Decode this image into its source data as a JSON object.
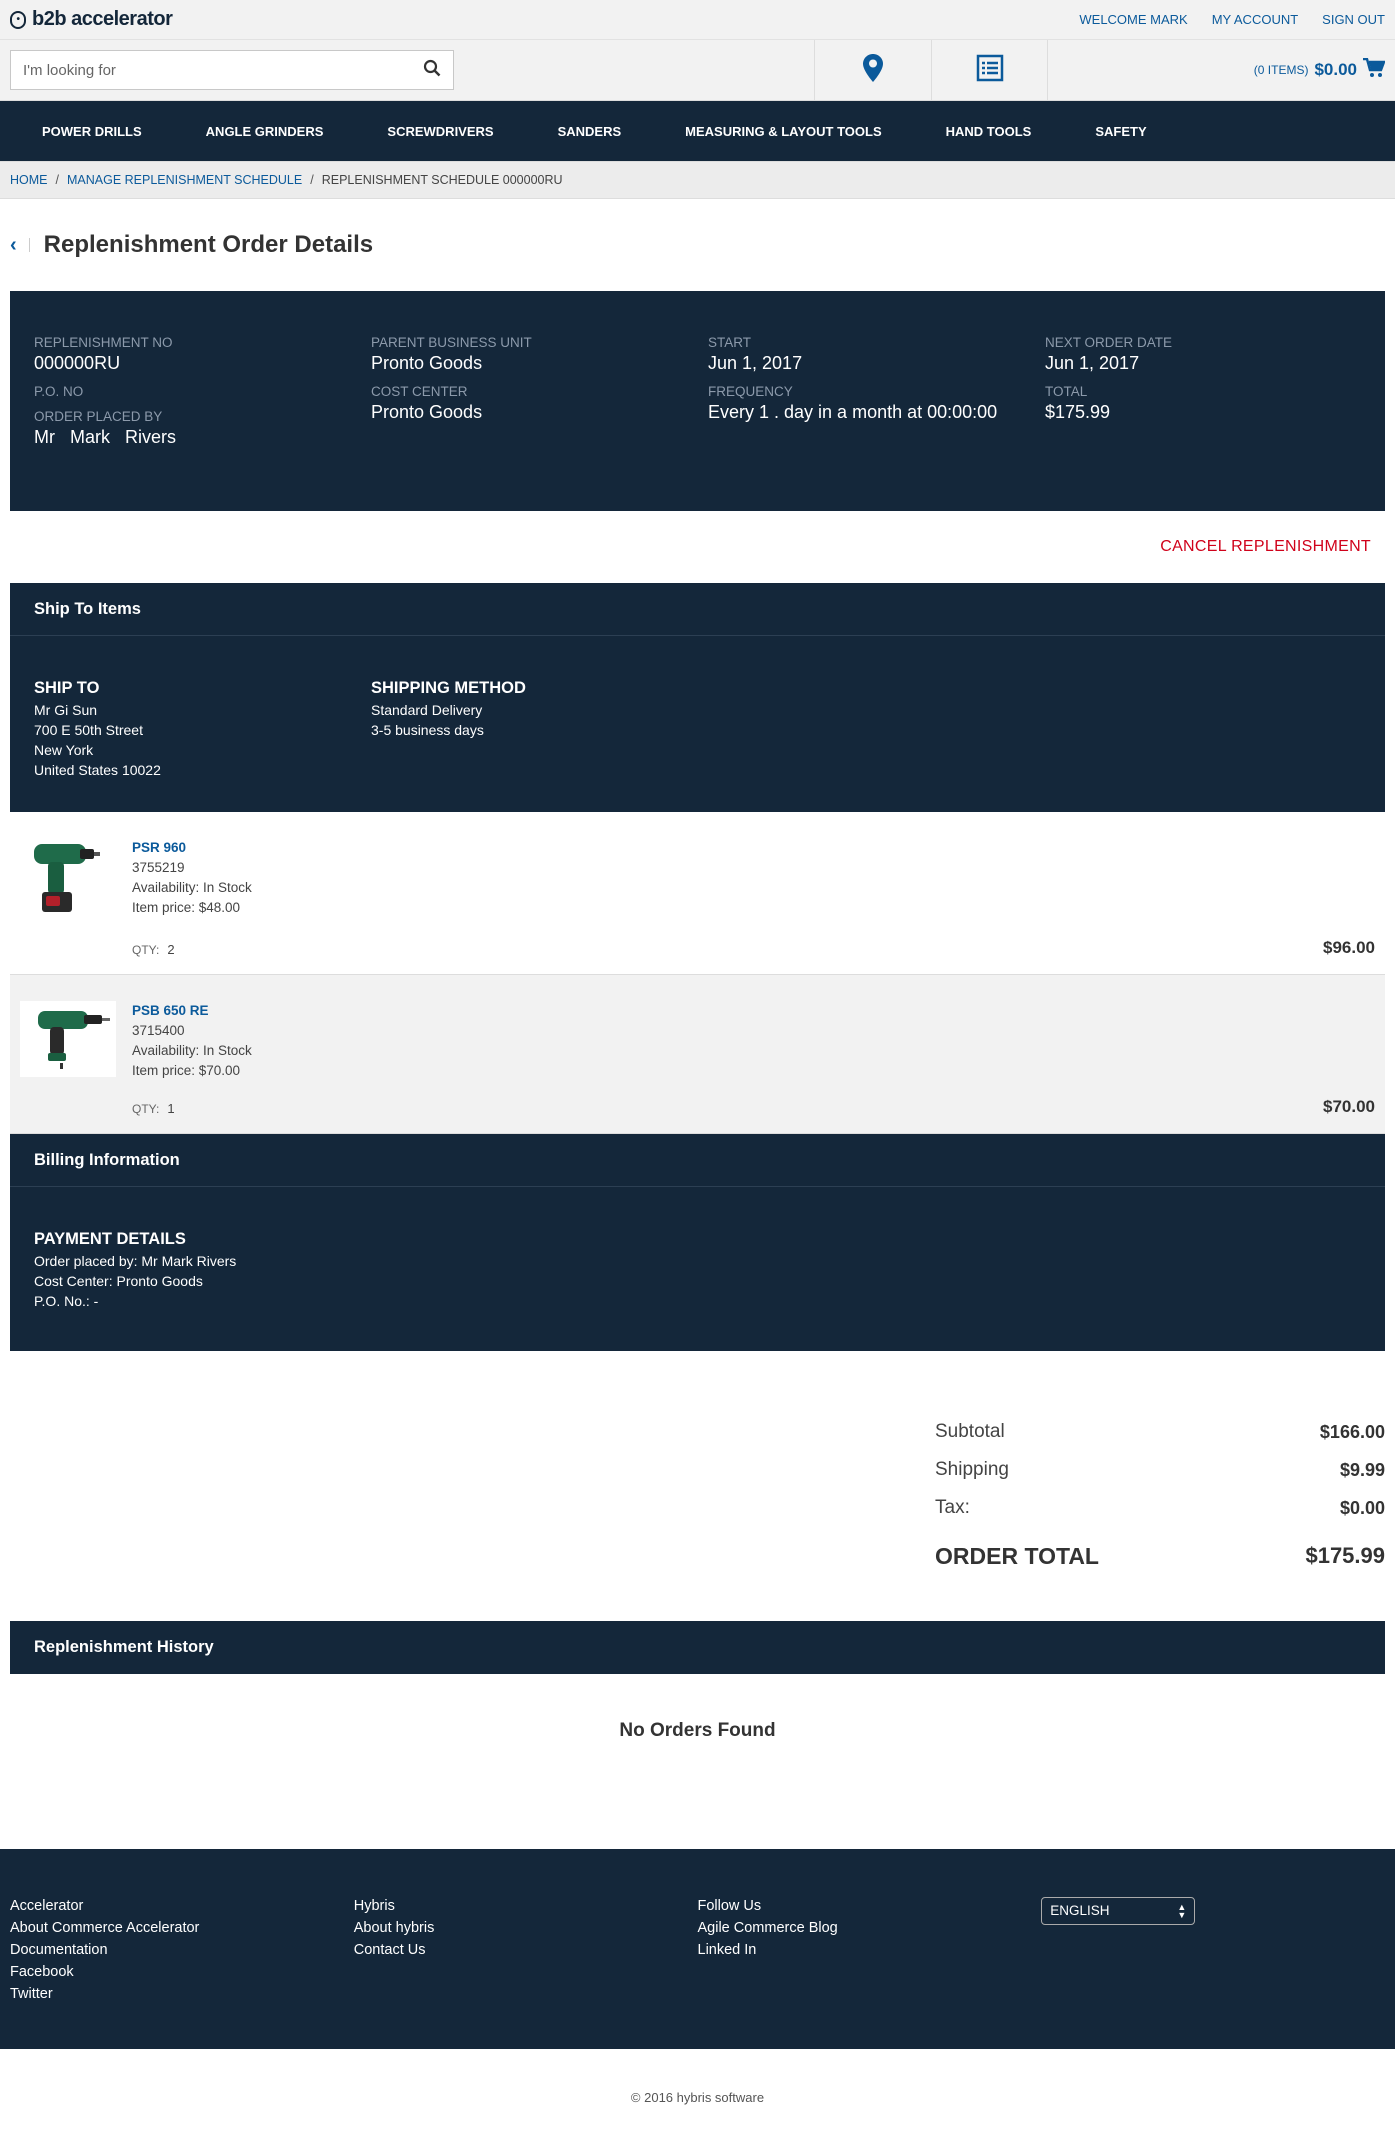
{
  "header": {
    "logo_text": "b2b accelerator",
    "welcome": "WELCOME MARK",
    "my_account": "MY ACCOUNT",
    "sign_out": "SIGN OUT",
    "search_placeholder": "I'm looking for",
    "cart_items": "(0 ITEMS)",
    "cart_total": "$0.00"
  },
  "nav": [
    "POWER DRILLS",
    "ANGLE GRINDERS",
    "SCREWDRIVERS",
    "SANDERS",
    "MEASURING & LAYOUT TOOLS",
    "HAND TOOLS",
    "SAFETY"
  ],
  "breadcrumb": {
    "home": "HOME",
    "manage": "MANAGE REPLENISHMENT SCHEDULE",
    "current": "REPLENISHMENT SCHEDULE 000000RU"
  },
  "page_title": "Replenishment Order Details",
  "summary": {
    "replenishment_no_label": "REPLENISHMENT NO",
    "replenishment_no": "000000RU",
    "po_no_label": "P.O. NO",
    "order_placed_by_label": "ORDER PLACED BY",
    "order_placed_by": "Mr  Mark  Rivers",
    "parent_bu_label": "PARENT BUSINESS UNIT",
    "parent_bu": "Pronto Goods",
    "cost_center_label": "COST CENTER",
    "cost_center": "Pronto Goods",
    "start_label": "START",
    "start": "Jun 1, 2017",
    "frequency_label": "FREQUENCY",
    "frequency": "Every 1 . day in a month at 00:00:00",
    "next_order_label": "NEXT ORDER DATE",
    "next_order": "Jun 1, 2017",
    "total_label": "TOTAL",
    "total": "$175.99"
  },
  "cancel_label": "CANCEL REPLENISHMENT",
  "ship_section": {
    "heading": "Ship To Items",
    "ship_to_title": "SHIP TO",
    "ship_to_lines": [
      "Mr  Gi Sun",
      "700 E 50th Street",
      "New York",
      "United States 10022"
    ],
    "method_title": "SHIPPING METHOD",
    "method_lines": [
      "Standard Delivery",
      "3-5 business days"
    ]
  },
  "items": [
    {
      "name": "PSR 960",
      "code": "3755219",
      "availability": "Availability: In Stock",
      "item_price": "Item price: $48.00",
      "qty_label": "QTY:",
      "qty": "2",
      "total": "$96.00"
    },
    {
      "name": "PSB 650 RE",
      "code": "3715400",
      "availability": "Availability: In Stock",
      "item_price": "Item price: $70.00",
      "qty_label": "QTY:",
      "qty": "1",
      "total": "$70.00"
    }
  ],
  "billing": {
    "heading": "Billing Information",
    "title": "PAYMENT DETAILS",
    "placed_by": "Order placed by: Mr Mark Rivers",
    "cost_center": "Cost Center: Pronto Goods",
    "po": "P.O. No.: -"
  },
  "totals": {
    "subtotal_label": "Subtotal",
    "subtotal": "$166.00",
    "shipping_label": "Shipping",
    "shipping": "$9.99",
    "tax_label": "Tax:",
    "tax": "$0.00",
    "order_total_label": "ORDER TOTAL",
    "order_total": "$175.99"
  },
  "history": {
    "heading": "Replenishment History",
    "empty": "No Orders Found"
  },
  "footer": {
    "col1": [
      "Accelerator",
      "About Commerce Accelerator",
      "Documentation",
      "Facebook",
      "Twitter"
    ],
    "col2": [
      "Hybris",
      "About hybris",
      "Contact Us"
    ],
    "col3": [
      "Follow Us",
      "Agile Commerce Blog",
      "Linked In"
    ],
    "language": "ENGLISH",
    "copyright": "© 2016 hybris software"
  },
  "colors": {
    "navy": "#14273a",
    "link_blue": "#0b5a9b",
    "cancel_red": "#d0021b"
  }
}
